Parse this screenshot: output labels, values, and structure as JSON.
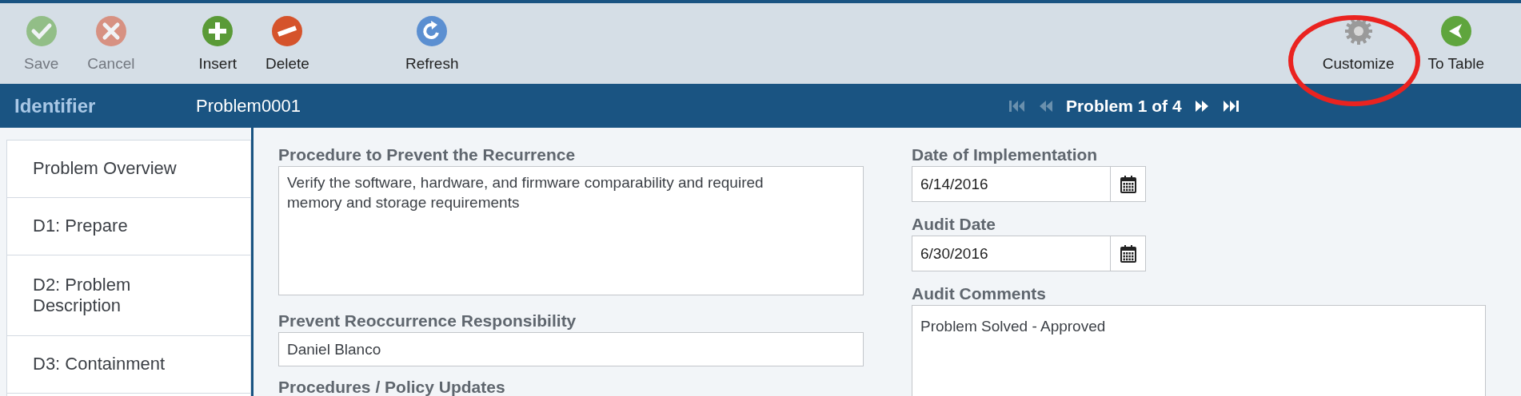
{
  "toolbar": {
    "groups": [
      [
        {
          "label": "Save",
          "kind": "check",
          "disabled": true
        },
        {
          "label": "Cancel",
          "kind": "cross",
          "disabled": true
        }
      ],
      [
        {
          "label": "Insert",
          "kind": "plus",
          "disabled": false
        },
        {
          "label": "Delete",
          "kind": "minus",
          "disabled": false
        }
      ],
      [
        {
          "label": "Refresh",
          "kind": "refresh",
          "disabled": false
        }
      ]
    ],
    "right": [
      {
        "label": "Customize",
        "kind": "gear",
        "disabled": false,
        "highlighted": true
      },
      {
        "label": "To Table",
        "kind": "back",
        "disabled": false,
        "highlighted": false
      }
    ]
  },
  "header": {
    "label": "Identifier",
    "value": "Problem0001",
    "pager": {
      "text": "Problem 1 of 4",
      "first_disabled": true,
      "prev_disabled": true,
      "next_disabled": false,
      "last_disabled": false
    }
  },
  "sidebar": {
    "items": [
      {
        "label": "Problem Overview",
        "selected": false
      },
      {
        "label": "D1: Prepare",
        "selected": false
      },
      {
        "label": "D2: Problem Description",
        "selected": false
      },
      {
        "label": "D3: Containment",
        "selected": false
      }
    ]
  },
  "form": {
    "left": [
      {
        "label": "Procedure to Prevent the Recurrence",
        "kind": "textarea",
        "value": "Verify the software, hardware, and firmware comparability and required memory and storage requirements"
      },
      {
        "label": "Prevent Reoccurrence Responsibility",
        "kind": "input",
        "value": "Daniel Blanco"
      },
      {
        "label": "Procedures / Policy Updates",
        "kind": "heading"
      }
    ],
    "right": [
      {
        "label": "Date of Implementation",
        "kind": "date",
        "value": "6/14/2016"
      },
      {
        "label": "Audit Date",
        "kind": "date",
        "value": "6/30/2016"
      },
      {
        "label": "Audit Comments",
        "kind": "textarea",
        "value": "Problem Solved - Approved"
      }
    ]
  }
}
